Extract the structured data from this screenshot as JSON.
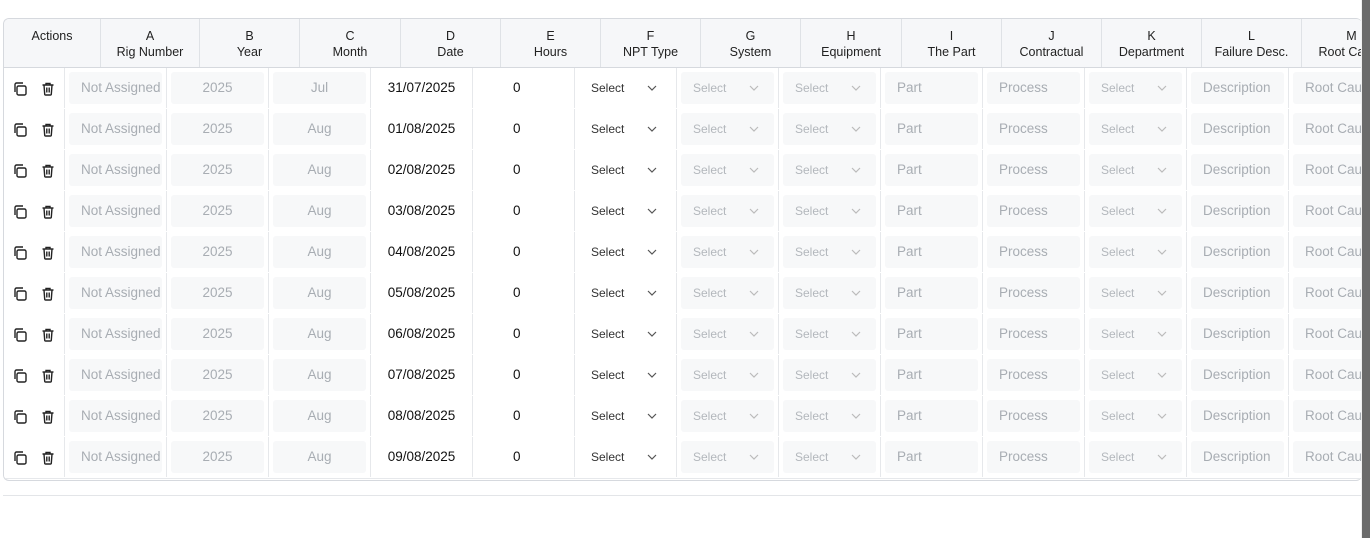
{
  "columns": [
    {
      "key": "actions",
      "letter": "",
      "title": "Actions"
    },
    {
      "key": "rig",
      "letter": "A",
      "title": "Rig Number"
    },
    {
      "key": "year",
      "letter": "B",
      "title": "Year"
    },
    {
      "key": "month",
      "letter": "C",
      "title": "Month"
    },
    {
      "key": "date",
      "letter": "D",
      "title": "Date"
    },
    {
      "key": "hours",
      "letter": "E",
      "title": "Hours"
    },
    {
      "key": "npt",
      "letter": "F",
      "title": "NPT Type"
    },
    {
      "key": "system",
      "letter": "G",
      "title": "System"
    },
    {
      "key": "equipment",
      "letter": "H",
      "title": "Equipment"
    },
    {
      "key": "part",
      "letter": "I",
      "title": "The Part"
    },
    {
      "key": "contractual",
      "letter": "J",
      "title": "Contractual"
    },
    {
      "key": "department",
      "letter": "K",
      "title": "Department"
    },
    {
      "key": "failure",
      "letter": "L",
      "title": "Failure Desc."
    },
    {
      "key": "root",
      "letter": "M",
      "title": "Root Cause"
    }
  ],
  "placeholders": {
    "rig": "Not Assigned",
    "select": "Select",
    "part": "Part",
    "contractual": "Process",
    "failure": "Description",
    "root": "Root Cause"
  },
  "icons": {
    "copy": "copy-icon",
    "delete": "trash-icon",
    "dropdown": "chevron-down-icon"
  },
  "colors": {
    "header_bg": "#f6f7f9",
    "border": "#d6d9de",
    "placeholder": "#a8adb3",
    "field_bg": "#f7f8f9"
  },
  "rows": [
    {
      "year": "2025",
      "month": "Jul",
      "date": "31/07/2025",
      "hours": "0"
    },
    {
      "year": "2025",
      "month": "Aug",
      "date": "01/08/2025",
      "hours": "0"
    },
    {
      "year": "2025",
      "month": "Aug",
      "date": "02/08/2025",
      "hours": "0"
    },
    {
      "year": "2025",
      "month": "Aug",
      "date": "03/08/2025",
      "hours": "0"
    },
    {
      "year": "2025",
      "month": "Aug",
      "date": "04/08/2025",
      "hours": "0"
    },
    {
      "year": "2025",
      "month": "Aug",
      "date": "05/08/2025",
      "hours": "0"
    },
    {
      "year": "2025",
      "month": "Aug",
      "date": "06/08/2025",
      "hours": "0"
    },
    {
      "year": "2025",
      "month": "Aug",
      "date": "07/08/2025",
      "hours": "0"
    },
    {
      "year": "2025",
      "month": "Aug",
      "date": "08/08/2025",
      "hours": "0"
    },
    {
      "year": "2025",
      "month": "Aug",
      "date": "09/08/2025",
      "hours": "0"
    }
  ]
}
